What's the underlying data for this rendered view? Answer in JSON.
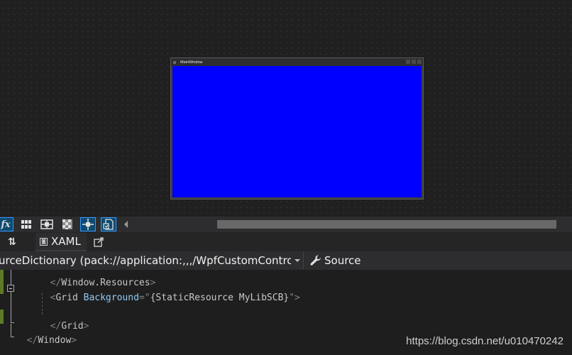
{
  "designer": {
    "preview_window": {
      "title": "MainWindow",
      "background_color": "#0000ff"
    }
  },
  "toolstrip": {
    "buttons": [
      {
        "name": "fx-effects",
        "label": "fx",
        "active": true
      },
      {
        "name": "grid",
        "active": false
      },
      {
        "name": "snap-gridlines",
        "active": false
      },
      {
        "name": "artboard-background",
        "active": false
      },
      {
        "name": "snap-to-snaplines",
        "active": true
      },
      {
        "name": "project-code",
        "active": true
      }
    ]
  },
  "tabs": {
    "swap_icon": "⇅",
    "xaml_tab_label": "XAML",
    "popout_icon": "popout-icon"
  },
  "navbar": {
    "scope_text": "ResourceDictionary (pack://application:,,,/WpfCustomControlLibr",
    "source_label": "Source"
  },
  "editor": {
    "lines": {
      "l1_open": "</",
      "l1_tag": "Window.Resources",
      "l1_close": ">",
      "l2_open": "<",
      "l2_tag": "Grid",
      "l2_attr": "Background",
      "l2_eq": "=\"",
      "l2_val": "{StaticResource MyLibSCB}",
      "l2_close": "\">",
      "l4_open": "</",
      "l4_tag": "Grid",
      "l4_close": ">",
      "l5_open": "</",
      "l5_tag": "Window",
      "l5_close": ">"
    }
  },
  "watermark": "https://blog.csdn.net/u010470242",
  "colors": {
    "accent": "#3399ff",
    "change_marker": "#5d7a27",
    "preview_fill": "#0000ff"
  }
}
